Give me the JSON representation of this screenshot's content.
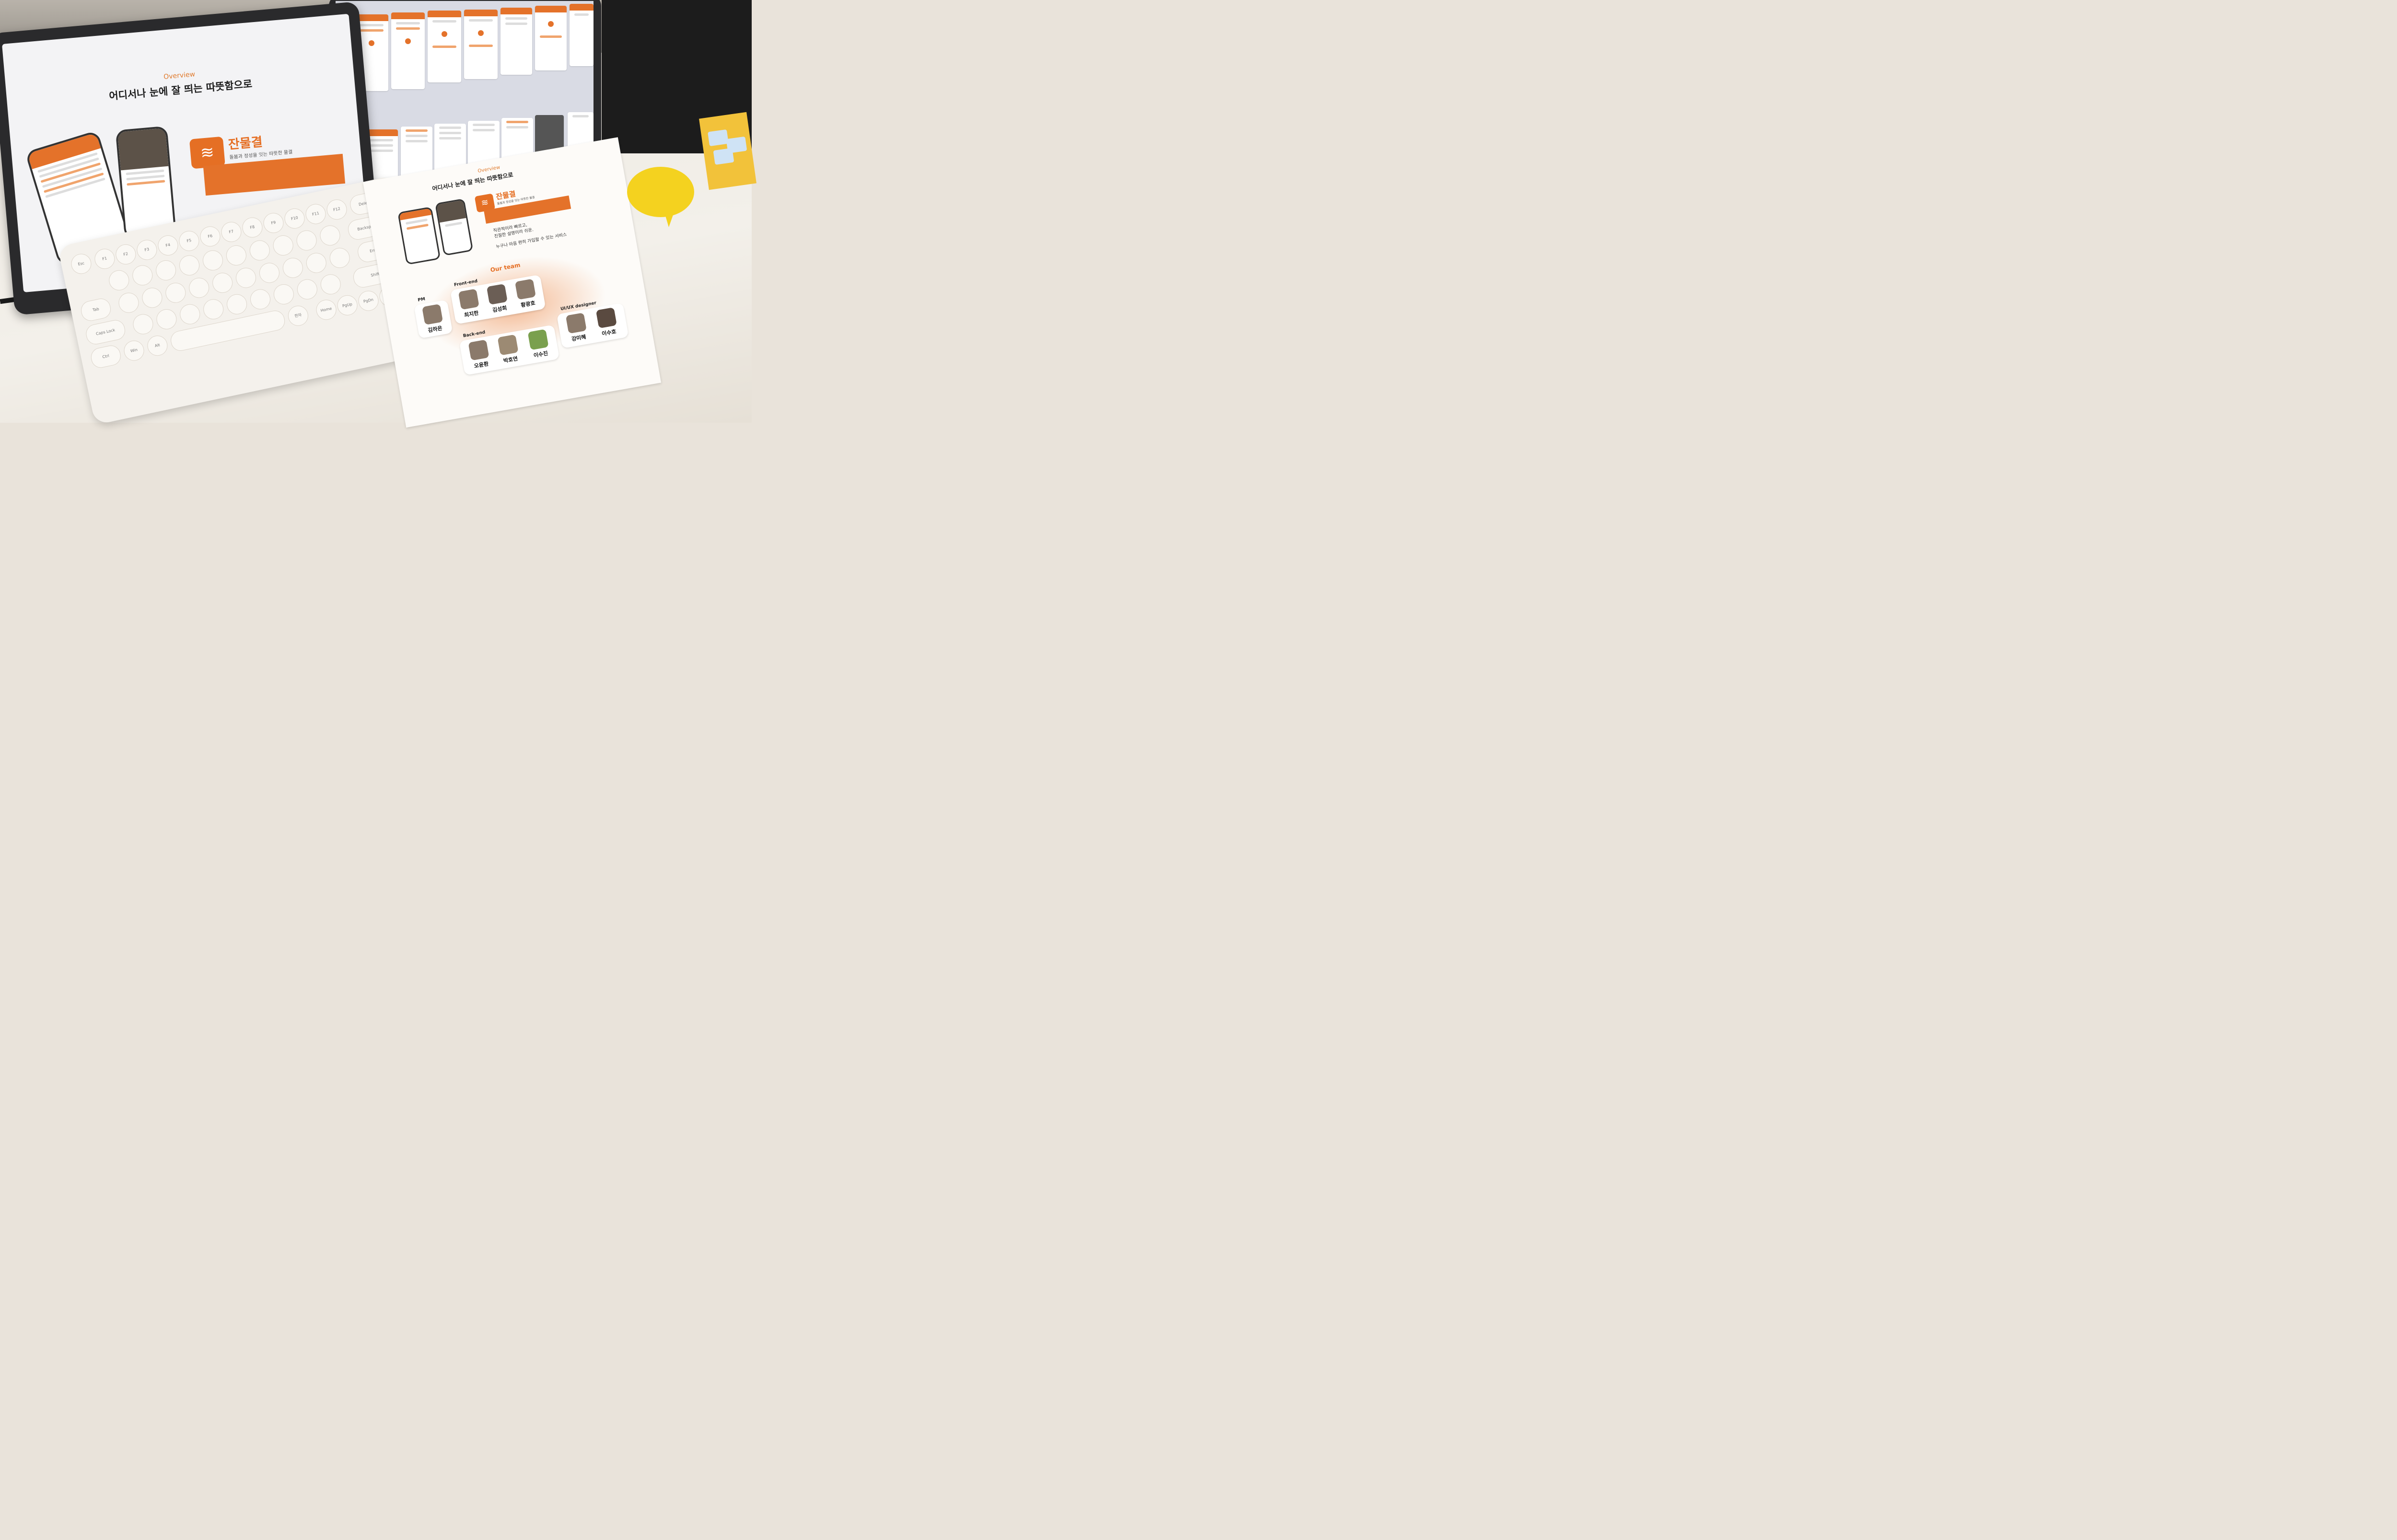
{
  "left_screen": {
    "overview": "Overview",
    "headline": "어디서나 눈에 잘 띄는 따뜻함으로",
    "brand_name": "잔물결",
    "brand_tagline": "돌봄과 정성을 잇는 따뜻한 물결"
  },
  "paper": {
    "overview": "Overview",
    "headline": "어디서나 눈에 잘 띄는 따뜻함으로",
    "brand_name": "잔물결",
    "brand_tagline": "돌봄과 정성을 잇는 따뜻한 물결",
    "desc_line1": "직관적이라 빠르고,",
    "desc_line2": "친절한 설명이라 쉬운.",
    "desc_line3": "누구나 마음 편히 가입할 수 있는 서비스",
    "team_title": "Our team",
    "roles": {
      "pm": "PM",
      "frontend": "Front-end",
      "backend": "Back-end",
      "design": "UI/UX designer"
    },
    "members": {
      "pm": [
        "김하은"
      ],
      "frontend": [
        "최지한",
        "김성희",
        "황광호"
      ],
      "backend": [
        "오윤환",
        "박호연",
        "이수진"
      ],
      "design": [
        "강미혜",
        "이수호"
      ]
    }
  },
  "keyboard": {
    "keys": [
      "Esc",
      "F1",
      "F2",
      "F3",
      "F4",
      "F5",
      "F6",
      "F7",
      "F8",
      "F9",
      "F10",
      "F11",
      "F12",
      "Delete",
      "Backspace",
      "Enter",
      "Shift",
      "Tab",
      "Caps Lock",
      "Ctrl",
      "Alt",
      "Win",
      "한자",
      "Home",
      "PgUp",
      "PgDn",
      "End"
    ]
  },
  "colors": {
    "brand_orange": "#e4722a",
    "sticky_yellow": "#f4d21f"
  }
}
